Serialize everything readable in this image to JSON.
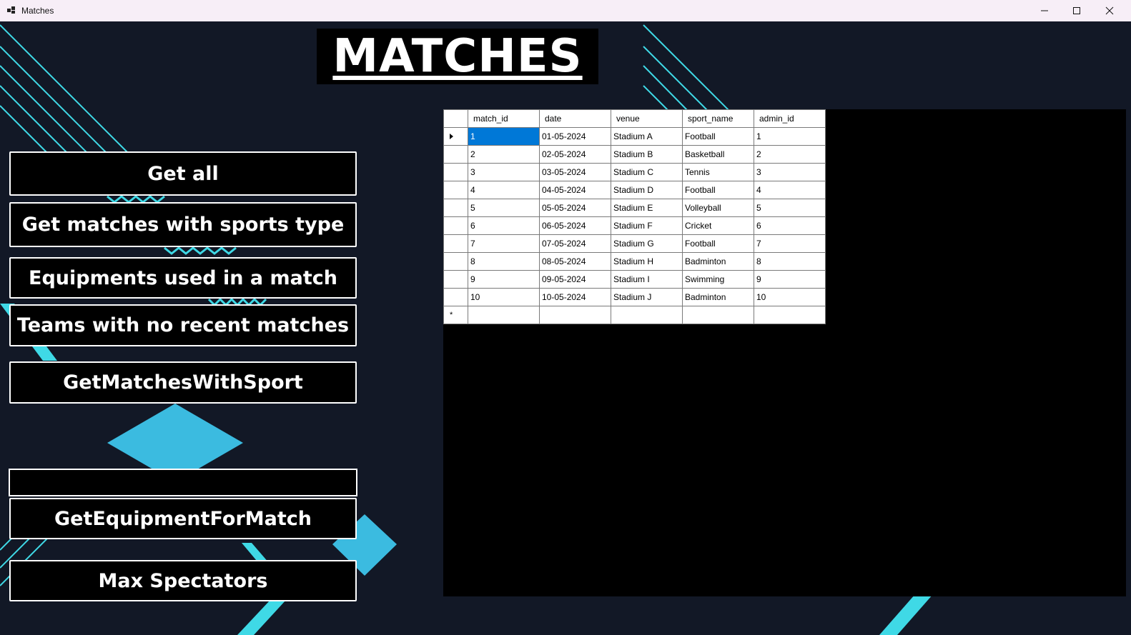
{
  "window": {
    "title": "Matches"
  },
  "page": {
    "heading": "MATCHES"
  },
  "buttons": {
    "get_all": "Get all",
    "get_matches_sports_type": "Get matches with sports type",
    "equipments_used": "Equipments used in a match",
    "teams_no_recent": "Teams with no recent matches",
    "get_matches_with_sport": "GetMatchesWithSport",
    "get_equipment_for_match": "GetEquipmentForMatch",
    "max_spectators": "Max Spectators"
  },
  "input": {
    "value": ""
  },
  "grid": {
    "columns": [
      "match_id",
      "date",
      "venue",
      "sport_name",
      "admin_id"
    ],
    "rows": [
      [
        "1",
        "01-05-2024",
        "Stadium A",
        "Football",
        "1"
      ],
      [
        "2",
        "02-05-2024",
        "Stadium B",
        "Basketball",
        "2"
      ],
      [
        "3",
        "03-05-2024",
        "Stadium C",
        "Tennis",
        "3"
      ],
      [
        "4",
        "04-05-2024",
        "Stadium D",
        "Football",
        "4"
      ],
      [
        "5",
        "05-05-2024",
        "Stadium E",
        "Volleyball",
        "5"
      ],
      [
        "6",
        "06-05-2024",
        "Stadium F",
        "Cricket",
        "6"
      ],
      [
        "7",
        "07-05-2024",
        "Stadium G",
        "Football",
        "7"
      ],
      [
        "8",
        "08-05-2024",
        "Stadium H",
        "Badminton",
        "8"
      ],
      [
        "9",
        "09-05-2024",
        "Stadium I",
        "Swimming",
        "9"
      ],
      [
        "10",
        "10-05-2024",
        "Stadium J",
        "Badminton",
        "10"
      ]
    ],
    "selected_row": 0,
    "selected_col": 0
  },
  "colors": {
    "accent": "#3fd9e6",
    "background": "#121826",
    "selection": "#0078d7"
  },
  "icons": [
    "app-icon",
    "minimize-icon",
    "maximize-icon",
    "close-icon",
    "current-row-arrow-icon",
    "new-row-star-icon"
  ]
}
